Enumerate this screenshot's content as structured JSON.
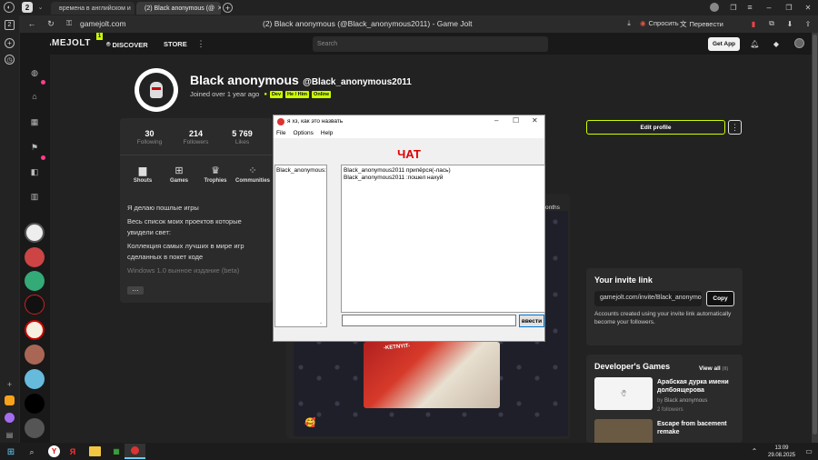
{
  "browser": {
    "tab_count": "2",
    "tabs": [
      {
        "title": "времена в английском и"
      },
      {
        "title": "(2) Black anonymous (@"
      }
    ],
    "url": "gamejolt.com",
    "page_title": "(2) Black anonymous (@Black_anonymous2011) - Game Jolt",
    "ask_label": "Спросить",
    "translate_label": "Перевести",
    "rail_badge": "2"
  },
  "gj": {
    "logo": "GAMEJOLT",
    "logo_badge": "1",
    "nav": [
      "DISCOVER",
      "STORE"
    ],
    "search_placeholder": "Search",
    "get_app": "Get App"
  },
  "profile": {
    "name": "Black anonymous",
    "handle": "@Black_anonymous2011",
    "joined": "Joined over 1 year ago",
    "badges": [
      "Dev",
      "He / Him",
      "Online"
    ],
    "stats": [
      {
        "value": "30",
        "label": "Following"
      },
      {
        "value": "214",
        "label": "Followers"
      },
      {
        "value": "5 769",
        "label": "Likes"
      }
    ],
    "tiles": [
      "Shouts",
      "Games",
      "Trophies",
      "Communities"
    ],
    "bio": [
      "Я делаю пошлые игры",
      "Весь список моих проектов которые увидели свет:",
      "Коллекция самых лучших в мире игр сделанных в покет коде",
      "Windows 1.0 вынное издание (beta)"
    ],
    "more_btn": "⋯",
    "edit_profile": "Edit profile",
    "months_text": "onths"
  },
  "invite": {
    "title": "Your invite link",
    "link": "gamejolt.com/invite/Black_anonymo",
    "copy": "Copy",
    "desc": "Accounts created using your invite link automatically become your followers."
  },
  "devgames": {
    "title": "Developer's Games",
    "view_all": "View all",
    "count": "(8)",
    "games": [
      {
        "title": "Арабская дурка имени долбоящерова",
        "by": "by",
        "author": "Black anonymous",
        "followers": "2 followers"
      },
      {
        "title": "Escape from bacement remake",
        "by": "",
        "author": "",
        "followers": ""
      }
    ]
  },
  "post": {
    "image_text": "-KETNYIT-",
    "emoji": "🥰"
  },
  "chatwin": {
    "title": "я хз, как это назвать",
    "menu": [
      "File",
      "Options",
      "Help"
    ],
    "heading": "ЧАТ",
    "users": [
      "Black_anonymous:"
    ],
    "messages": [
      "Black_anonymous2011 припёрся(-лась)",
      "Black_anonymous2011 :пошел нахуй"
    ],
    "input_value": "",
    "send": "ввести",
    "heading_color": "#e00000"
  },
  "taskbar": {
    "time": "13:09",
    "date": "29.08.2025"
  }
}
